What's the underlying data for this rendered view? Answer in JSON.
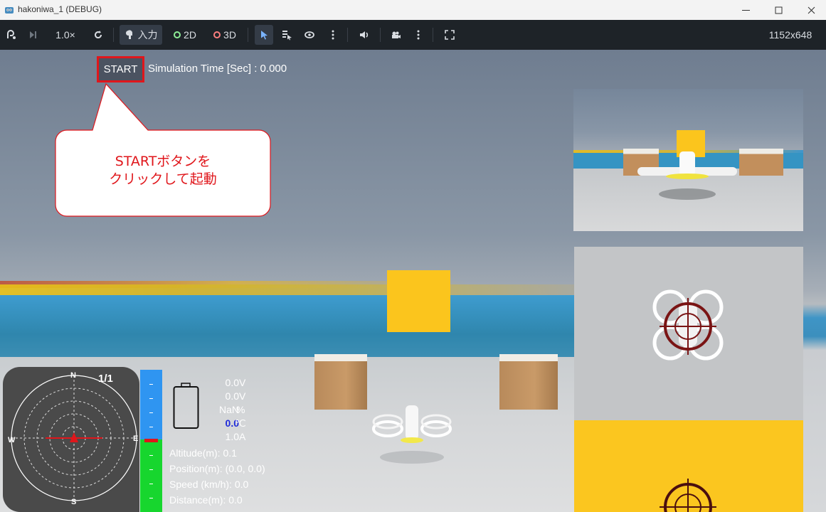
{
  "window": {
    "title": "hakoniwa_1 (DEBUG)"
  },
  "toolbar": {
    "speed": "1.0×",
    "input_label": "入力",
    "mode_2d": "2D",
    "mode_3d": "3D",
    "resolution": "1152x648"
  },
  "viewport": {
    "start_label": "START",
    "sim_time": "Simulation Time [Sec] : 0.000",
    "callout_line1": "STARTボタンを",
    "callout_line2": "クリックして起動"
  },
  "hud": {
    "compass_count": "1/1",
    "compass_n": "N",
    "compass_s": "S",
    "compass_e": "E",
    "compass_w": "W",
    "battery": [
      {
        "value": "0.0",
        "unit": "V",
        "color": "#ffffff"
      },
      {
        "value": "0.0",
        "unit": "V",
        "color": "#ffffff"
      },
      {
        "value": "NaN",
        "unit": "%",
        "color": "#ffffff"
      },
      {
        "value": "0.0",
        "unit": "℃",
        "color": "#1f2bd9"
      },
      {
        "value": "1.0",
        "unit": "A",
        "color": "#ffffff"
      }
    ],
    "altitude": "Altitude(m): 0.1",
    "position": "Position(m): (0.0, 0.0)",
    "speed": "Speed (km/h): 0.0",
    "distance": "Distance(m): 0.0"
  },
  "colors": {
    "accent_red": "#e0161b",
    "toolbar_bg": "#1e2328",
    "altitude_blue": "#2f95f1",
    "altitude_green": "#17d62e",
    "box_yellow": "#fbc51d"
  }
}
